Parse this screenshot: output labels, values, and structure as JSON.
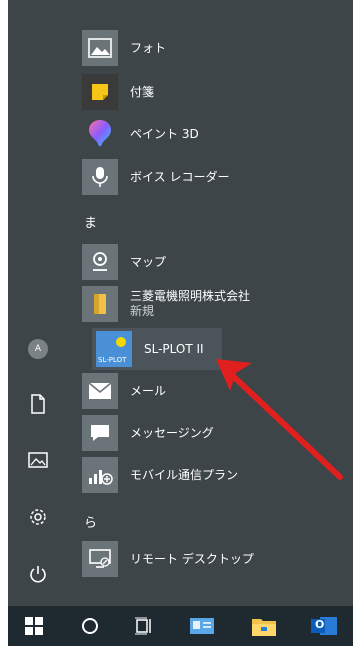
{
  "sections": {
    "ma": "ま",
    "ra": "ら"
  },
  "apps": {
    "photos": "フォト",
    "sticky_notes": "付箋",
    "paint3d": "ペイント 3D",
    "voice_recorder": "ボイス レコーダー",
    "maps": "マップ",
    "folder_name": "三菱電機照明株式会社",
    "folder_badge": "新規",
    "slplot": "SL-PLOT II",
    "slplot_tile_text": "SL-PLOT",
    "mail": "メール",
    "messaging": "メッセージング",
    "mobile_plan": "モバイル通信プラン",
    "remote_desktop": "リモート デスクトップ"
  },
  "rail": {
    "avatar_initial": "A"
  },
  "taskbar": {
    "outlook_letter": "O"
  },
  "colors": {
    "start_bg": "#3d4549",
    "tile_bg": "#6b7479",
    "taskbar_bg": "#1f2a30",
    "annotation_arrow": "#e01f1f"
  }
}
